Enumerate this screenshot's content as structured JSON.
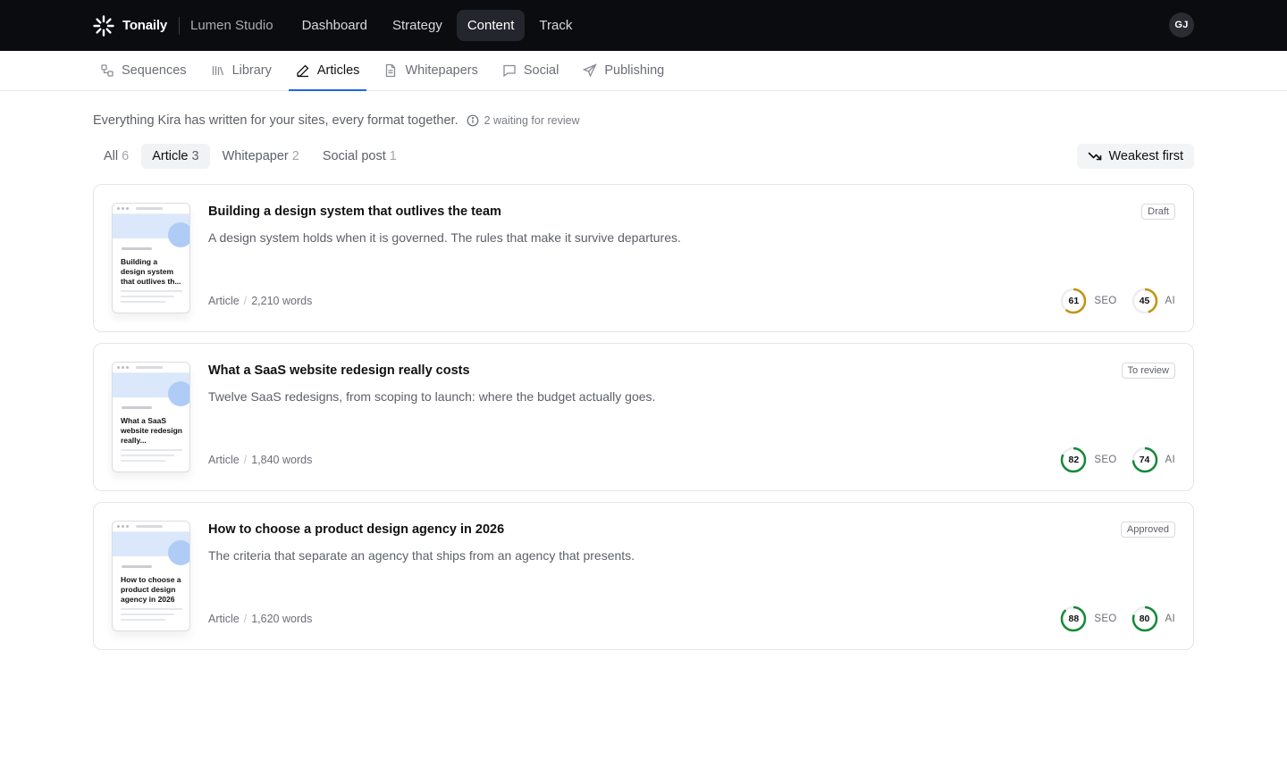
{
  "colors": {
    "accent": "#2563eb",
    "topbar": "#0b0c10",
    "score_high": "#16893a",
    "score_mid": "#c49413"
  },
  "topbar": {
    "brand": "Tonaily",
    "workspace": "Lumen Studio",
    "nav": [
      {
        "label": "Dashboard",
        "active": false
      },
      {
        "label": "Strategy",
        "active": false
      },
      {
        "label": "Content",
        "active": true
      },
      {
        "label": "Track",
        "active": false
      }
    ],
    "avatar_initials": "GJ"
  },
  "subnav": [
    {
      "label": "Sequences",
      "icon": "sequences-icon",
      "active": false
    },
    {
      "label": "Library",
      "icon": "library-icon",
      "active": false
    },
    {
      "label": "Articles",
      "icon": "pen-icon",
      "active": true
    },
    {
      "label": "Whitepapers",
      "icon": "document-icon",
      "active": false
    },
    {
      "label": "Social",
      "icon": "chat-icon",
      "active": false
    },
    {
      "label": "Publishing",
      "icon": "send-icon",
      "active": false
    }
  ],
  "intro": {
    "text": "Everything Kira has written for your sites, every format together.",
    "waiting": "2 waiting for review"
  },
  "filters": [
    {
      "label": "All",
      "count": "6",
      "active": false
    },
    {
      "label": "Article",
      "count": "3",
      "active": true
    },
    {
      "label": "Whitepaper",
      "count": "2",
      "active": false
    },
    {
      "label": "Social post",
      "count": "1",
      "active": false
    }
  ],
  "sort": {
    "label": "Weakest first"
  },
  "articles": [
    {
      "title": "Building a design system that outlives the team",
      "thumb_title": "Building a design system that outlives th...",
      "description": "A design system holds when it is governed. The rules that make it survive departures.",
      "type": "Article",
      "words": "2,210 words",
      "status": "Draft",
      "seo": {
        "value": 61,
        "label": "SEO"
      },
      "ai": {
        "value": 45,
        "label": "AI"
      }
    },
    {
      "title": "What a SaaS website redesign really costs",
      "thumb_title": "What a SaaS website redesign really...",
      "description": "Twelve SaaS redesigns, from scoping to launch: where the budget actually goes.",
      "type": "Article",
      "words": "1,840 words",
      "status": "To review",
      "seo": {
        "value": 82,
        "label": "SEO"
      },
      "ai": {
        "value": 74,
        "label": "AI"
      }
    },
    {
      "title": "How to choose a product design agency in 2026",
      "thumb_title": "How to choose a product design agency in 2026",
      "description": "The criteria that separate an agency that ships from an agency that presents.",
      "type": "Article",
      "words": "1,620 words",
      "status": "Approved",
      "seo": {
        "value": 88,
        "label": "SEO"
      },
      "ai": {
        "value": 80,
        "label": "AI"
      }
    }
  ]
}
